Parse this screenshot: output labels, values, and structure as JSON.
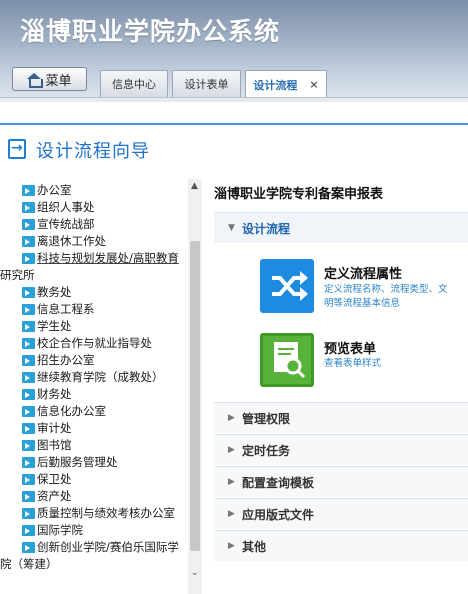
{
  "app": {
    "title": "淄博职业学院办公系统"
  },
  "menu": {
    "label": "菜单",
    "icon": "home-icon"
  },
  "tabs": [
    {
      "label": "信息中心",
      "active": false
    },
    {
      "label": "设计表单",
      "active": false
    },
    {
      "label": "设计流程",
      "active": true,
      "close": "×"
    }
  ],
  "wizard": {
    "title": "设计流程向导",
    "icon": "wizard-icon"
  },
  "tree": {
    "items": [
      {
        "label": "办公室"
      },
      {
        "label": "组织人事处"
      },
      {
        "label": "宣传统战部"
      },
      {
        "label": "离退休工作处"
      },
      {
        "label": "科技与规划发展处/高职教育",
        "line2": "研究所"
      },
      {
        "label": "教务处"
      },
      {
        "label": "信息工程系"
      },
      {
        "label": "学生处"
      },
      {
        "label": "校企合作与就业指导处"
      },
      {
        "label": "招生办公室"
      },
      {
        "label": "继续教育学院（成教处）"
      },
      {
        "label": "财务处"
      },
      {
        "label": "信息化办公室"
      },
      {
        "label": "审计处"
      },
      {
        "label": "图书馆"
      },
      {
        "label": "后勤服务管理处"
      },
      {
        "label": "保卫处"
      },
      {
        "label": "资产处"
      },
      {
        "label": "质量控制与绩效考核办公室"
      },
      {
        "label": "国际学院"
      },
      {
        "label": "创新创业学院/赛伯乐国际学",
        "line2": "院（筹建）"
      }
    ]
  },
  "main": {
    "form_title": "淄博职业学院专利备案申报表",
    "sections": [
      {
        "label": "设计流程",
        "expanded": true
      },
      {
        "label": "管理权限",
        "expanded": false
      },
      {
        "label": "定时任务",
        "expanded": false
      },
      {
        "label": "配置查询模板",
        "expanded": false
      },
      {
        "label": "应用版式文件",
        "expanded": false
      },
      {
        "label": "其他",
        "expanded": false
      }
    ],
    "cards": [
      {
        "title": "定义流程属性",
        "desc_line1": "定义流程名称、流程类型、文",
        "desc_line2": "明等流程基本信息",
        "icon": "shuffle-icon"
      },
      {
        "title": "预览表单",
        "desc_line1": "查看表单样式",
        "icon": "preview-form-icon"
      }
    ]
  },
  "colors": {
    "accent": "#1f72c9",
    "card_blue": "#1d8be0",
    "card_green": "#58b23a",
    "header_top": "#7d8fa8"
  }
}
